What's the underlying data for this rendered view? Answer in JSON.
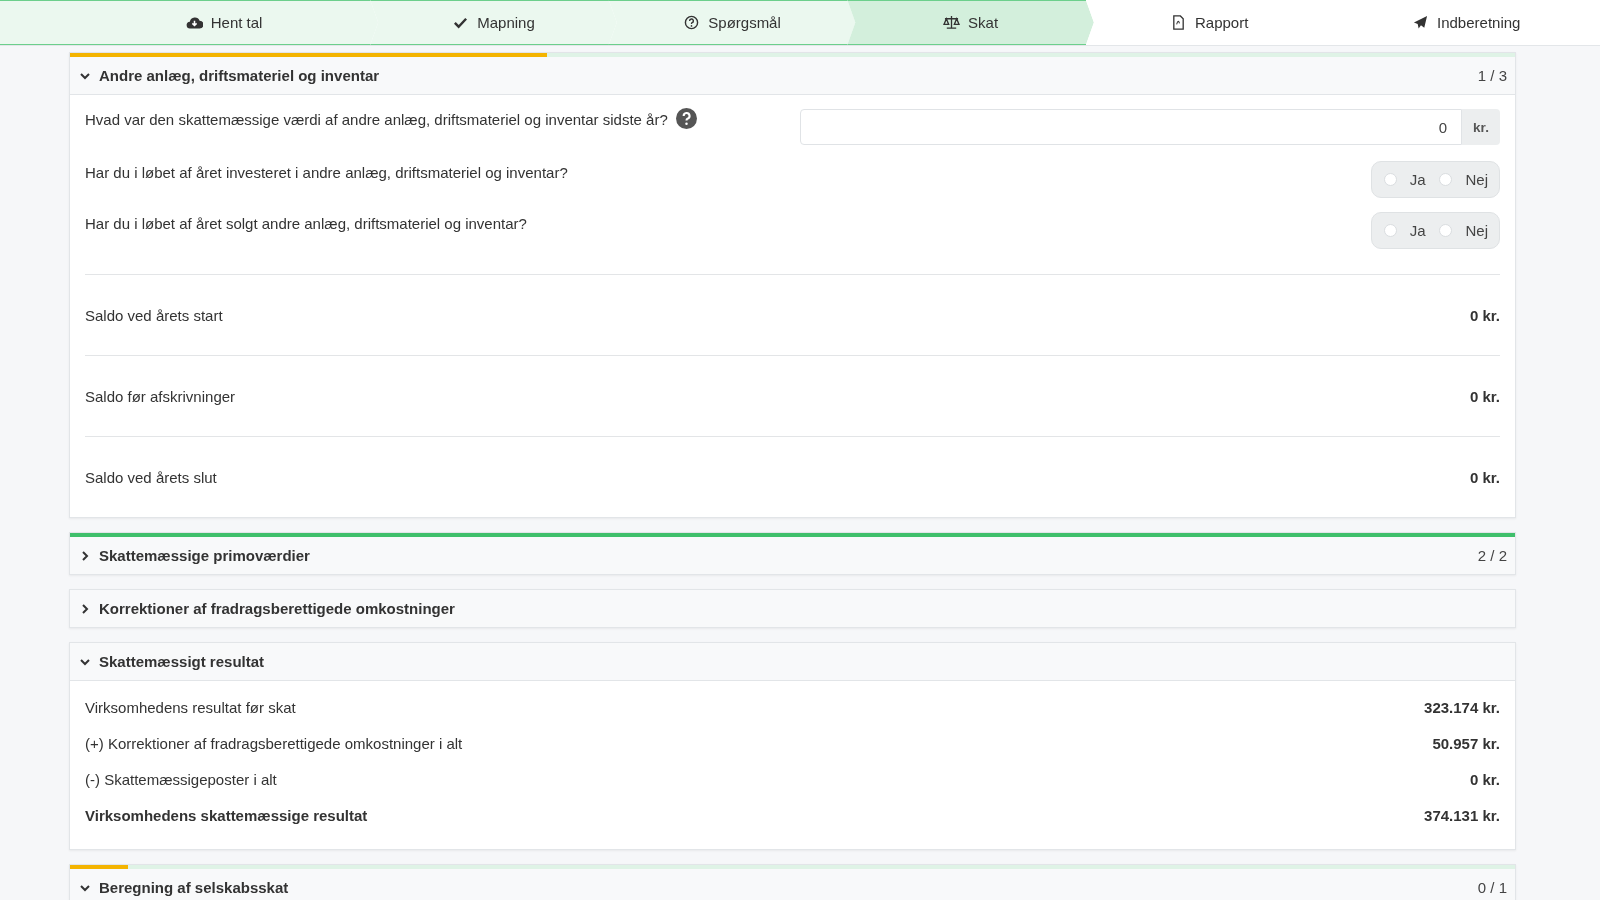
{
  "steps": [
    {
      "label": "Hent tal",
      "completed": true,
      "selected": false
    },
    {
      "label": "Mapning",
      "completed": true,
      "selected": false
    },
    {
      "label": "Spørgsmål",
      "completed": true,
      "selected": false
    },
    {
      "label": "Skat",
      "completed": true,
      "selected": true
    },
    {
      "label": "Rapport",
      "completed": false,
      "selected": false
    },
    {
      "label": "Indberetning",
      "completed": false,
      "selected": false
    }
  ],
  "sections": [
    {
      "title": "Andre anlæg, driftsmateriel og inventar",
      "count": "1 / 3",
      "level": 0.33,
      "expanded": true,
      "questions": [
        {
          "kind": "amount",
          "text": "Hvad var den skattemæssige værdi af andre anlæg, driftsmateriel og inventar sidste år?",
          "help": true,
          "value": "0",
          "unit": "kr."
        },
        {
          "kind": "yesno",
          "text": "Har du i løbet af året investeret i andre anlæg, driftsmateriel og inventar?",
          "options": [
            {
              "label": "Ja",
              "selected": false
            },
            {
              "label": "Nej",
              "selected": false
            }
          ]
        },
        {
          "kind": "yesno",
          "text": "Har du i løbet af året solgt andre anlæg, driftsmateriel og inventar?",
          "options": [
            {
              "label": "Ja",
              "selected": false
            },
            {
              "label": "Nej",
              "selected": false
            }
          ]
        }
      ],
      "balances": [
        {
          "label": "Saldo ved årets start",
          "value": "0 kr."
        },
        {
          "label": "Saldo før afskrivninger",
          "value": "0 kr."
        },
        {
          "label": "Saldo ved årets slut",
          "value": "0 kr."
        }
      ]
    },
    {
      "title": "Skattemæssige primoværdier",
      "count": "2 / 2",
      "level": 1,
      "expanded": false
    },
    {
      "title": "Korrektioner af fradragsberettigede omkostninger",
      "expanded": false
    },
    {
      "title": "Skattemæssigt resultat",
      "expanded": true,
      "lines": [
        {
          "kind": "line",
          "label": "Virksomhedens resultat før skat",
          "value": "323.174 kr."
        },
        {
          "kind": "line",
          "label": "(+) Korrektioner af fradragsberettigede omkostninger i alt",
          "value": "50.957 kr."
        },
        {
          "kind": "line",
          "label": "(-) Skattemæssigeposter i alt",
          "value": "0 kr."
        },
        {
          "kind": "total",
          "label": "Virksomhedens skattemæssige resultat",
          "value": "374.131 kr."
        }
      ]
    },
    {
      "title": "Beregning af selskabsskat",
      "count": "0 / 1",
      "level": 0.04,
      "expanded": true
    }
  ]
}
